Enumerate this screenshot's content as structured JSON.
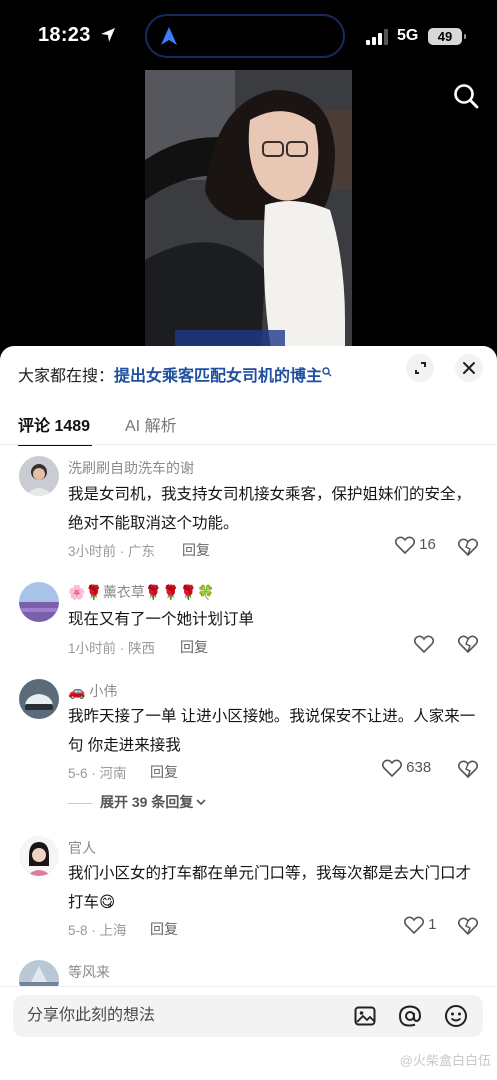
{
  "status": {
    "time": "18:23",
    "network": "5G",
    "battery": "49"
  },
  "hot_search": {
    "prefix": "大家都在搜：",
    "query": "提出女乘客匹配女司机的博主"
  },
  "tabs": [
    {
      "label": "评论 1489"
    },
    {
      "label": "AI 解析"
    }
  ],
  "comments": [
    {
      "user": "洗刷刷自助洗车的谢",
      "text": "我是女司机，我支持女司机接女乘客，保护姐妹们的安全，绝对不能取消这个功能。",
      "meta": "3小时前 · 广东",
      "reply": "回复",
      "likes": "16"
    },
    {
      "user": "🌸🌹薰衣草🌹🌹🌹🍀",
      "text": "现在又有了一个她计划订单",
      "meta": "1小时前 · 陕西",
      "reply": "回复",
      "likes": ""
    },
    {
      "user": "🚗 小伟",
      "text": "我昨天接了一单 让进小区接她。我说保安不让进。人家来一句 你走进来接我",
      "meta": "5-6 · 河南",
      "reply": "回复",
      "likes": "638",
      "expand": "展开 39 条回复"
    },
    {
      "user": "官人",
      "text": "我们小区女的打车都在单元门口等，我每次都是去大门口才打车😋",
      "meta": "5-8 · 上海",
      "reply": "回复",
      "likes": "1"
    },
    {
      "user": "等风来"
    }
  ],
  "input": {
    "placeholder": "分享你此刻的想法"
  },
  "watermark": "@火柴盒白白伍"
}
